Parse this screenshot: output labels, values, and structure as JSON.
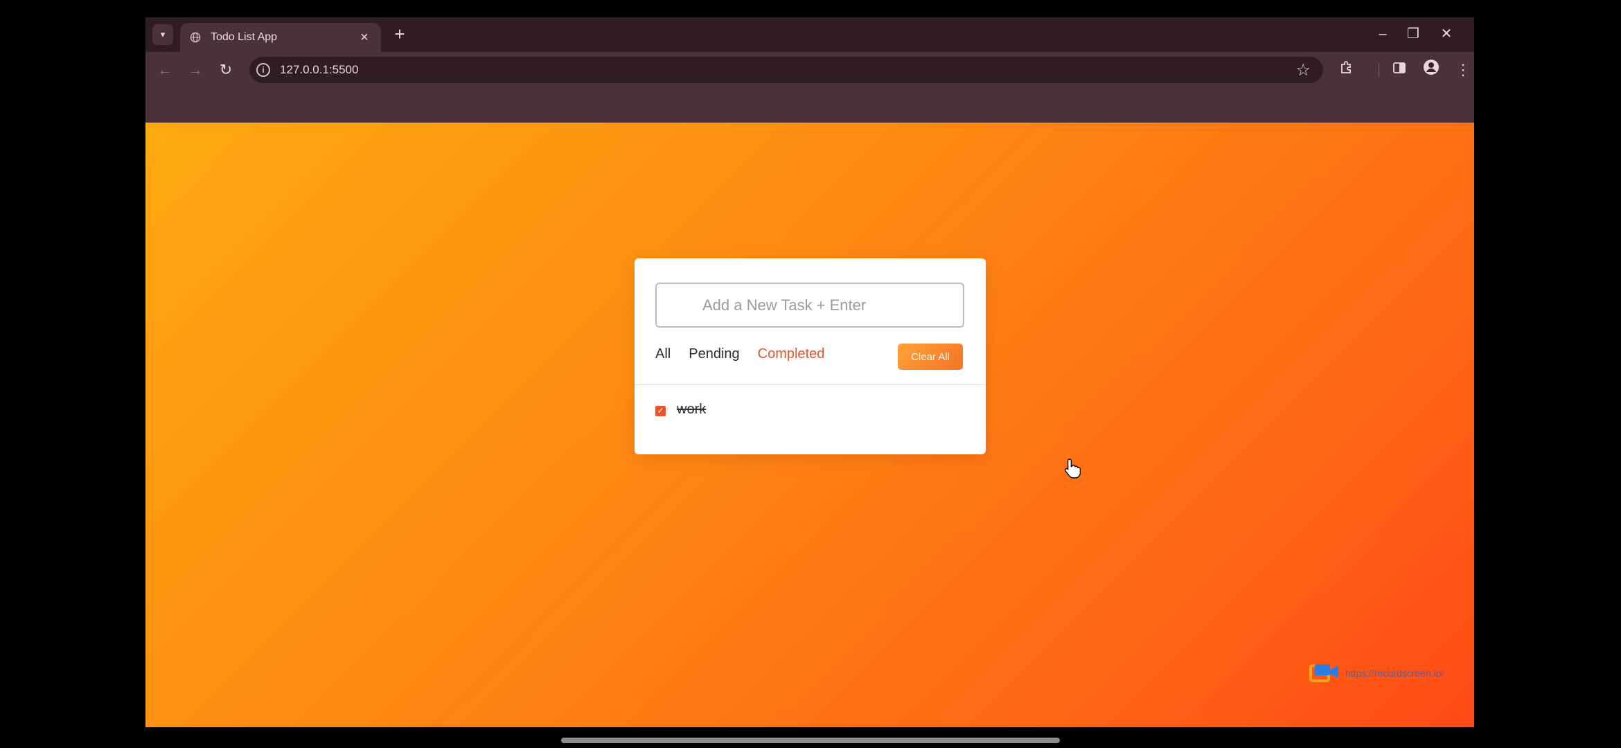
{
  "browser": {
    "tab_title": "Todo List App",
    "url": "127.0.0.1:5500",
    "icons": [
      "chevron-down-icon",
      "globe-icon",
      "close-icon",
      "plus-icon",
      "minimize-icon",
      "restore-icon",
      "back-icon",
      "forward-icon",
      "reload-icon",
      "info-icon",
      "star-icon",
      "extensions-icon",
      "side-panel-icon",
      "profile-icon",
      "more-vert-icon"
    ]
  },
  "app": {
    "input_placeholder": "Add a New Task + Enter",
    "filters": [
      "All",
      "Pending",
      "Completed"
    ],
    "active_filter": "Completed",
    "clear_label": "Clear All",
    "tasks": [
      {
        "text": "work",
        "completed": true
      }
    ]
  },
  "watermark": {
    "text": "https://recordscreen.io/"
  },
  "colors": {
    "accent": "#e5542a",
    "gradient_start": "#fea912",
    "gradient_end": "#ff4a16",
    "browser_frame": "#4a3238"
  }
}
